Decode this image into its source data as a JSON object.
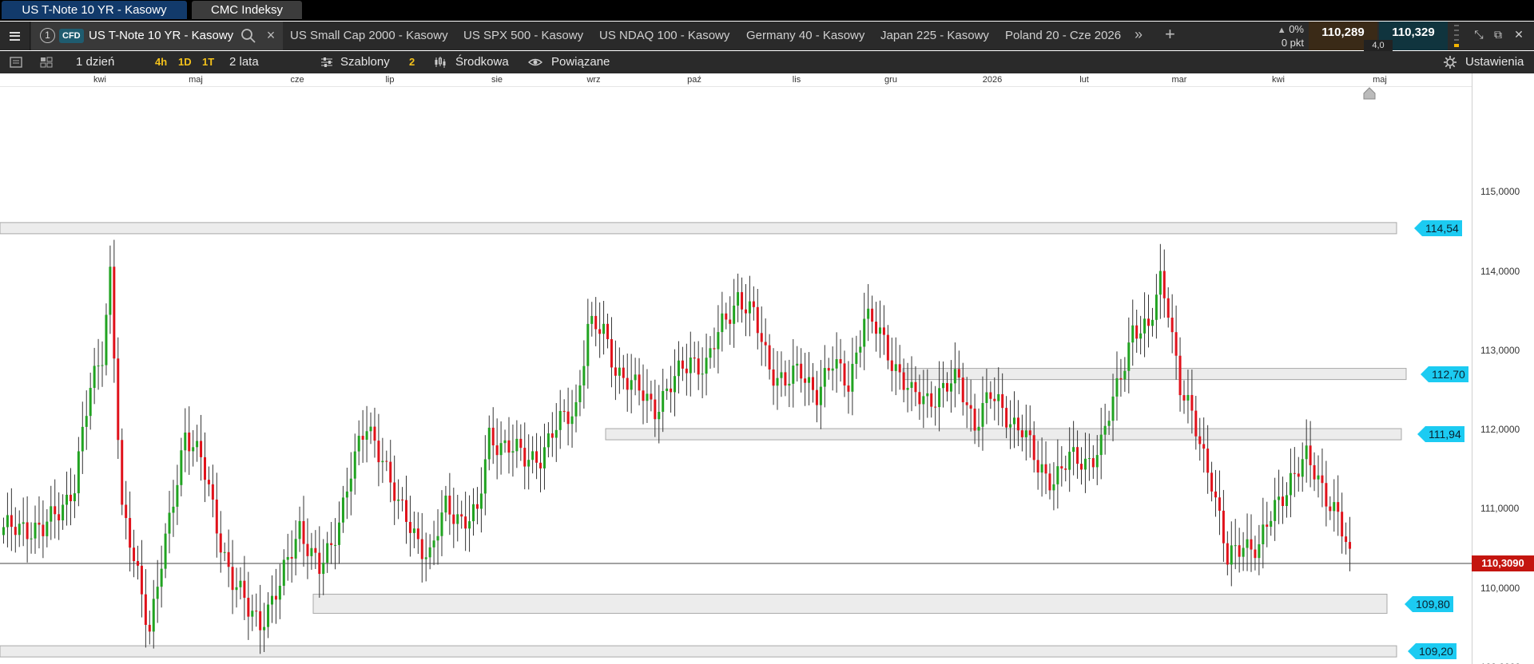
{
  "workspace_tabs": [
    "US T-Note 10 YR - Kasowy",
    "CMC Indeksy"
  ],
  "instrument": {
    "index": "1",
    "type_badge": "CFD",
    "name": "US T-Note 10 YR - Kasowy",
    "other_tabs": [
      "US Small Cap 2000 - Kasowy",
      "US SPX 500 - Kasowy",
      "US NDAQ 100 - Kasowy",
      "Germany 40 - Kasowy",
      "Japan 225 - Kasowy",
      "Poland 20 - Cze 2026"
    ],
    "change_pct": "0%",
    "change_pts": "0 pkt",
    "bid": "110,289",
    "ask": "110,329",
    "spread": "4,0"
  },
  "toolbar": {
    "interval": "1 dzień",
    "quick_intervals": [
      "4h",
      "1D",
      "1T"
    ],
    "range": "2 lata",
    "templates": "Szablony",
    "templates_count": "2",
    "price_type": "Środkowa",
    "related": "Powiązane",
    "settings": "Ustawienia"
  },
  "colors": {
    "up": "#21a321",
    "down": "#e0121b",
    "level_tag": "#1ccbf2",
    "current_price": "#c4150f"
  },
  "chart_data": {
    "type": "candlestick",
    "x_labels": [
      "kwi",
      "maj",
      "cze",
      "lip",
      "sie",
      "wrz",
      "paź",
      "lis",
      "gru",
      "2026",
      "lut",
      "mar",
      "kwi",
      "maj"
    ],
    "y_ticks": [
      "115,0000",
      "114,0000",
      "113,0000",
      "112,0000",
      "111,0000",
      "110,0000",
      "109,0000"
    ],
    "ylim": [
      108.3,
      115.7
    ],
    "current_price": "110,3090",
    "levels": [
      {
        "label": "114,54",
        "value": 114.54
      },
      {
        "label": "112,70",
        "value": 112.7
      },
      {
        "label": "111,94",
        "value": 111.94
      },
      {
        "label": "109,80",
        "value": 109.8
      },
      {
        "label": "109,20",
        "value": 109.2
      }
    ],
    "anchors": [
      [
        0,
        110.7
      ],
      [
        5,
        110.8
      ],
      [
        10,
        110.7
      ],
      [
        18,
        111.3
      ],
      [
        22,
        112.5
      ],
      [
        25,
        113.0
      ],
      [
        27,
        114.0
      ],
      [
        30,
        110.9
      ],
      [
        34,
        110.2
      ],
      [
        37,
        109.5
      ],
      [
        42,
        110.8
      ],
      [
        46,
        112.0
      ],
      [
        50,
        111.6
      ],
      [
        55,
        110.6
      ],
      [
        58,
        110.1
      ],
      [
        62,
        109.7
      ],
      [
        65,
        109.6
      ],
      [
        70,
        110.0
      ],
      [
        75,
        110.8
      ],
      [
        80,
        110.2
      ],
      [
        83,
        110.5
      ],
      [
        88,
        111.5
      ],
      [
        92,
        112.0
      ],
      [
        96,
        111.7
      ],
      [
        100,
        111.0
      ],
      [
        104,
        110.7
      ],
      [
        108,
        110.4
      ],
      [
        112,
        111.0
      ],
      [
        116,
        110.9
      ],
      [
        120,
        110.9
      ],
      [
        123,
        111.9
      ],
      [
        128,
        111.8
      ],
      [
        132,
        111.6
      ],
      [
        136,
        111.7
      ],
      [
        140,
        112.0
      ],
      [
        145,
        112.3
      ],
      [
        148,
        113.3
      ],
      [
        152,
        113.2
      ],
      [
        155,
        112.8
      ],
      [
        160,
        112.5
      ],
      [
        165,
        112.3
      ],
      [
        170,
        112.6
      ],
      [
        174,
        112.9
      ],
      [
        178,
        112.8
      ],
      [
        182,
        113.3
      ],
      [
        186,
        113.7
      ],
      [
        190,
        113.4
      ],
      [
        194,
        112.8
      ],
      [
        198,
        112.6
      ],
      [
        202,
        112.7
      ],
      [
        206,
        112.5
      ],
      [
        210,
        112.8
      ],
      [
        214,
        112.6
      ],
      [
        218,
        113.4
      ],
      [
        222,
        113.2
      ],
      [
        226,
        112.8
      ],
      [
        230,
        112.4
      ],
      [
        234,
        112.4
      ],
      [
        238,
        112.5
      ],
      [
        242,
        112.6
      ],
      [
        246,
        112.1
      ],
      [
        250,
        112.4
      ],
      [
        254,
        112.2
      ],
      [
        258,
        112.0
      ],
      [
        262,
        111.5
      ],
      [
        266,
        111.4
      ],
      [
        270,
        111.6
      ],
      [
        274,
        111.6
      ],
      [
        278,
        111.8
      ],
      [
        282,
        112.5
      ],
      [
        286,
        113.3
      ],
      [
        290,
        113.2
      ],
      [
        293,
        113.9
      ],
      [
        295,
        113.6
      ],
      [
        298,
        112.5
      ],
      [
        302,
        112.0
      ],
      [
        306,
        111.4
      ],
      [
        310,
        110.3
      ],
      [
        314,
        110.6
      ],
      [
        318,
        110.5
      ],
      [
        322,
        111.0
      ],
      [
        326,
        111.4
      ],
      [
        330,
        111.6
      ],
      [
        334,
        111.3
      ],
      [
        338,
        110.9
      ],
      [
        341,
        110.31
      ]
    ]
  }
}
